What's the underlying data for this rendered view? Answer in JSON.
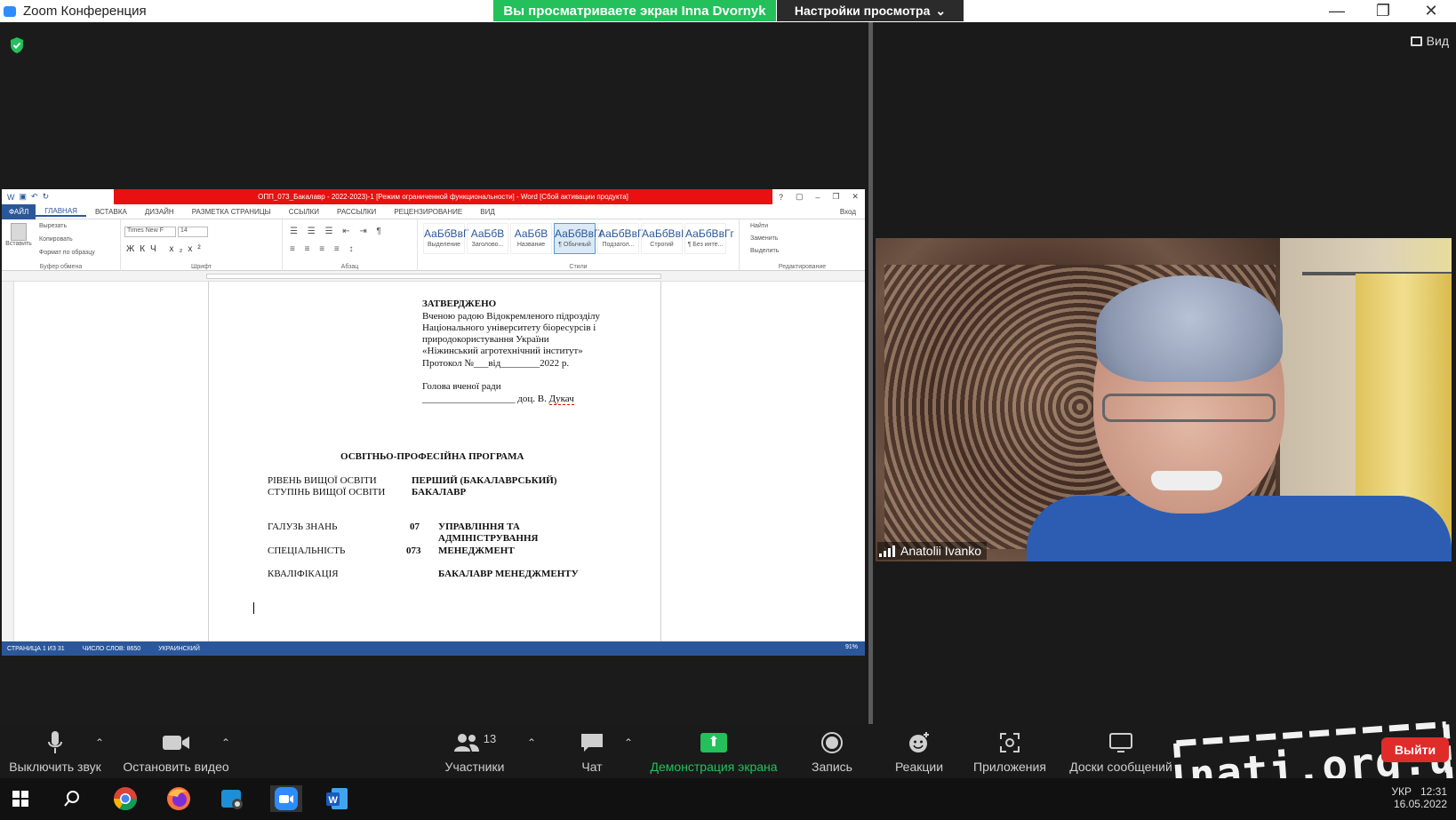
{
  "window": {
    "app_title": "Zoom Конференция",
    "banner": "Вы просматриваете экран Inna Dvornyk",
    "view_settings": "Настройки просмотра",
    "view_button": "Вид"
  },
  "word": {
    "title": "ОПП_073_Бакалавр - 2022-2023)-1 [Режим ограниченной функциональности] - Word [Сбой активации продукта]",
    "tabs": [
      "ФАЙЛ",
      "ГЛАВНАЯ",
      "ВСТАВКА",
      "ДИЗАЙН",
      "РАЗМЕТКА СТРАНИЦЫ",
      "ССЫЛКИ",
      "РАССЫЛКИ",
      "РЕЦЕНЗИРОВАНИЕ",
      "ВИД"
    ],
    "signin": "Вход",
    "clipboard": {
      "paste": "Вставить",
      "cut": "Вырезать",
      "copy": "Копировать",
      "format_painter": "Формат по образцу",
      "label": "Буфер обмена"
    },
    "font": {
      "name": "Times New F",
      "size": "14",
      "label": "Шрифт"
    },
    "paragraph_label": "Абзац",
    "styles": {
      "label": "Стили",
      "items": [
        {
          "preview": "АаБбВвГ",
          "name": "Выделение"
        },
        {
          "preview": "АаБбВ",
          "name": "Заголово..."
        },
        {
          "preview": "АаБбВ",
          "name": "Название"
        },
        {
          "preview": "АаБбВвГг",
          "name": "¶ Обычный"
        },
        {
          "preview": "АаБбВвГ",
          "name": "Подзагол..."
        },
        {
          "preview": "АаБбВвI",
          "name": "Строгий"
        },
        {
          "preview": "АаБбВвГг",
          "name": "¶ Без инте..."
        }
      ]
    },
    "editing": {
      "find": "Найти",
      "replace": "Заменить",
      "select": "Выделить",
      "label": "Редактирование"
    },
    "document": {
      "approved": "ЗАТВЕРДЖЕНО",
      "approved_lines": [
        "Вченою радою Відокремленого підрозділу",
        "Національного університету біоресурсів і",
        "природокористування України",
        "«Ніжинський агротехнічний інститут»",
        "Протокол №___від________2022 р."
      ],
      "head": "Голова вченої ради",
      "signature_line": "___________________ доц. В. ",
      "signature_name": "Дукач",
      "program_title": "ОСВІТНЬО-ПРОФЕСІЙНА ПРОГРАМА",
      "rows": [
        {
          "label": "РІВЕНЬ ВИЩОЇ ОСВІТИ",
          "code": "",
          "value": "ПЕРШИЙ (БАКАЛАВРСЬКИЙ)"
        },
        {
          "label": "СТУПІНЬ ВИЩОЇ ОСВІТИ",
          "code": "",
          "value": "БАКАЛАВР"
        },
        {
          "label": "ГАЛУЗЬ ЗНАНЬ",
          "code": "07",
          "value": "УПРАВЛІННЯ ТА"
        },
        {
          "label": "",
          "code": "",
          "value": "АДМІНІСТРУВАННЯ"
        },
        {
          "label": "СПЕЦІАЛЬНІСТЬ",
          "code": "073",
          "value": "МЕНЕДЖМЕНТ"
        },
        {
          "label": "КВАЛІФІКАЦІЯ",
          "code": "",
          "value": "БАКАЛАВР МЕНЕДЖМЕНТУ"
        }
      ]
    },
    "status": {
      "page": "СТРАНИЦА 1 ИЗ 31",
      "words": "ЧИСЛО СЛОВ: 8650",
      "lang": "УКРАИНСКИЙ",
      "zoom": "91%"
    }
  },
  "video": {
    "participant_name": "Anatolii Ivanko"
  },
  "toolbar": {
    "mute": "Выключить звук",
    "stop_video": "Остановить видео",
    "participants": "Участники",
    "participants_count": "13",
    "chat": "Чат",
    "share": "Демонстрация экрана",
    "record": "Запись",
    "reactions": "Реакции",
    "apps": "Приложения",
    "whiteboards": "Доски сообщений",
    "exit": "Выйти"
  },
  "watermark": {
    "text": "nati.org.ua"
  },
  "taskbar": {
    "lang": "УКР",
    "time": "12:31",
    "date": "16.05.2022"
  },
  "colors": {
    "share_green": "#23c05c",
    "word_blue": "#2b579a",
    "title_red": "#e81010",
    "exit_red": "#e02b2b"
  }
}
